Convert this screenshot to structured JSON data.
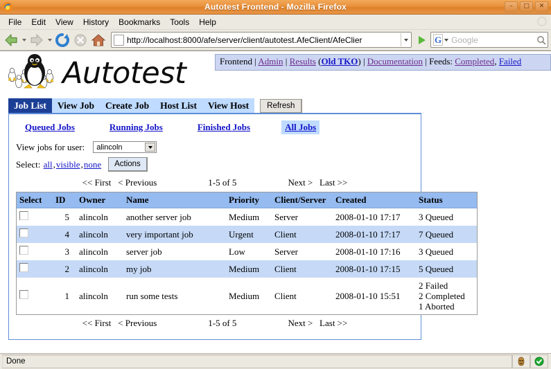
{
  "window": {
    "title": "Autotest Frontend - Mozilla Firefox",
    "minimize_label": "–",
    "maximize_label": "□",
    "close_label": "✕"
  },
  "menubar": {
    "items": [
      {
        "label": "File"
      },
      {
        "label": "Edit"
      },
      {
        "label": "View"
      },
      {
        "label": "History"
      },
      {
        "label": "Bookmarks"
      },
      {
        "label": "Tools"
      },
      {
        "label": "Help"
      }
    ]
  },
  "toolbar": {
    "back": "back-icon",
    "forward": "forward-icon",
    "reload": "reload-icon",
    "stop": "stop-icon",
    "home": "home-icon",
    "url_value": "http://localhost:8000/afe/server/client/autotest.AfeClient/AfeClier",
    "search_placeholder": "Google",
    "search_engine": "G"
  },
  "site": {
    "logo_text": "Autotest",
    "navlinks": {
      "frontend": "Frontend",
      "admin": "Admin",
      "results": "Results",
      "old_tko": "Old TKO",
      "documentation": "Documentation",
      "feeds_label": "Feeds:",
      "feeds_completed": "Completed",
      "feeds_failed": "Failed"
    }
  },
  "tabs": [
    {
      "label": "Job List",
      "active": true
    },
    {
      "label": "View Job",
      "active": false
    },
    {
      "label": "Create Job",
      "active": false
    },
    {
      "label": "Host List",
      "active": false
    },
    {
      "label": "View Host",
      "active": false
    }
  ],
  "refresh_label": "Refresh",
  "subtabs": [
    {
      "label": "Queued Jobs",
      "selected": false
    },
    {
      "label": "Running Jobs",
      "selected": false
    },
    {
      "label": "Finished Jobs",
      "selected": false
    },
    {
      "label": "All Jobs",
      "selected": true
    }
  ],
  "filter": {
    "user_label": "View jobs for user:",
    "user_value": "alincoln"
  },
  "selection": {
    "label": "Select:",
    "all": "all",
    "visible": "visible",
    "none": "none",
    "comma1": ",",
    "comma2": ",",
    "actions_label": "Actions"
  },
  "paging": {
    "first": "<< First",
    "previous": "< Previous",
    "range": "1-5 of 5",
    "next": "Next >",
    "last": "Last >>"
  },
  "table": {
    "columns": [
      "Select",
      "ID",
      "Owner",
      "Name",
      "Priority",
      "Client/Server",
      "Created",
      "Status"
    ],
    "rows": [
      {
        "id": "5",
        "owner": "alincoln",
        "name": "another server job",
        "priority": "Medium",
        "client_server": "Server",
        "created": "2008-01-10 17:17",
        "status": [
          "3 Queued"
        ]
      },
      {
        "id": "4",
        "owner": "alincoln",
        "name": "very important job",
        "priority": "Urgent",
        "client_server": "Client",
        "created": "2008-01-10 17:17",
        "status": [
          "7 Queued"
        ]
      },
      {
        "id": "3",
        "owner": "alincoln",
        "name": "server job",
        "priority": "Low",
        "client_server": "Server",
        "created": "2008-01-10 17:16",
        "status": [
          "3 Queued"
        ]
      },
      {
        "id": "2",
        "owner": "alincoln",
        "name": "my job",
        "priority": "Medium",
        "client_server": "Client",
        "created": "2008-01-10 17:15",
        "status": [
          "5 Queued"
        ]
      },
      {
        "id": "1",
        "owner": "alincoln",
        "name": "run some tests",
        "priority": "Medium",
        "client_server": "Client",
        "created": "2008-01-10 15:51",
        "status": [
          "2 Failed",
          "2 Completed",
          "1 Aborted"
        ]
      }
    ]
  },
  "statusbar": {
    "text": "Done",
    "adblock_icon": "adblock-icon",
    "secure_icon": "check-badge-icon"
  },
  "colors": {
    "titlebar": "#e8913c",
    "active_tab": "#1c3f96",
    "tab": "#bfdbff",
    "table_header": "#95bbf0",
    "row_alt": "#c6daf7",
    "panel_border": "#5d8ed6",
    "link": "#1414c8",
    "visited_link": "#6a2a8c"
  }
}
